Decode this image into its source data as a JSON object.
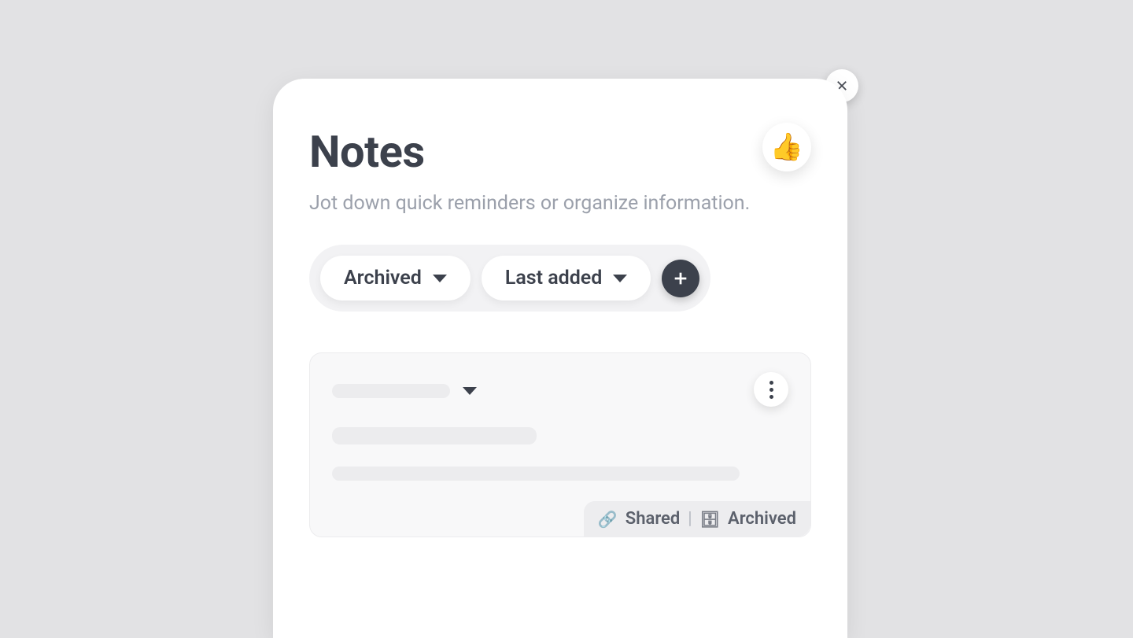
{
  "header": {
    "title": "Notes",
    "subtitle": "Jot down quick reminders or organize information.",
    "reaction_emoji": "👍"
  },
  "filters": {
    "status": {
      "selected": "Archived"
    },
    "sort": {
      "selected": "Last added"
    }
  },
  "note_card": {
    "tags": {
      "shared_label": "Shared",
      "archived_label": "Archived",
      "separator": "|"
    }
  },
  "icons": {
    "link": "🔗",
    "archive": "🗄"
  }
}
